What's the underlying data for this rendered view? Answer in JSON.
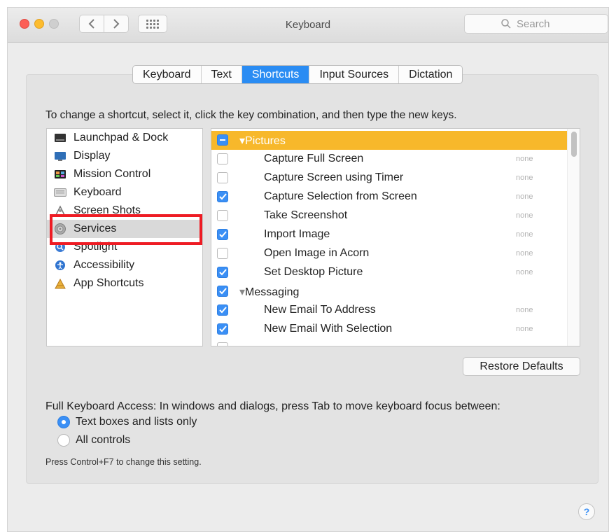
{
  "window": {
    "title": "Keyboard",
    "search_placeholder": "Search"
  },
  "tabs": [
    {
      "label": "Keyboard",
      "active": false
    },
    {
      "label": "Text",
      "active": false
    },
    {
      "label": "Shortcuts",
      "active": true
    },
    {
      "label": "Input Sources",
      "active": false
    },
    {
      "label": "Dictation",
      "active": false
    }
  ],
  "instructions": "To change a shortcut, select it, click the key combination, and then type the new keys.",
  "categories": [
    {
      "label": "Launchpad & Dock",
      "icon": "launchpad-dock-icon"
    },
    {
      "label": "Display",
      "icon": "display-icon"
    },
    {
      "label": "Mission Control",
      "icon": "mission-control-icon"
    },
    {
      "label": "Keyboard",
      "icon": "keyboard-icon"
    },
    {
      "label": "Screen Shots",
      "icon": "screenshots-icon"
    },
    {
      "label": "Services",
      "icon": "services-gear-icon",
      "selected": true
    },
    {
      "label": "Spotlight",
      "icon": "spotlight-icon"
    },
    {
      "label": "Accessibility",
      "icon": "accessibility-icon"
    },
    {
      "label": "App Shortcuts",
      "icon": "app-shortcuts-icon"
    }
  ],
  "shortcuts": [
    {
      "type": "group",
      "label": "Pictures",
      "state": "mixed",
      "selected": true
    },
    {
      "type": "item",
      "label": "Capture Full Screen",
      "checked": false,
      "key": "none"
    },
    {
      "type": "item",
      "label": "Capture Screen using Timer",
      "checked": false,
      "key": "none"
    },
    {
      "type": "item",
      "label": "Capture Selection from Screen",
      "checked": true,
      "key": "none"
    },
    {
      "type": "item",
      "label": "Take Screenshot",
      "checked": false,
      "key": "none"
    },
    {
      "type": "item",
      "label": "Import Image",
      "checked": true,
      "key": "none"
    },
    {
      "type": "item",
      "label": "Open Image in Acorn",
      "checked": false,
      "key": "none"
    },
    {
      "type": "item",
      "label": "Set Desktop Picture",
      "checked": true,
      "key": "none"
    },
    {
      "type": "group",
      "label": "Messaging",
      "state": "checked",
      "selected": false
    },
    {
      "type": "item",
      "label": "New Email To Address",
      "checked": true,
      "key": "none"
    },
    {
      "type": "item",
      "label": "New Email With Selection",
      "checked": true,
      "key": "none"
    }
  ],
  "restore_button": "Restore Defaults",
  "full_keyboard_access": {
    "label": "Full Keyboard Access: In windows and dialogs, press Tab to move keyboard focus between:",
    "options": [
      {
        "label": "Text boxes and lists only",
        "selected": true
      },
      {
        "label": "All controls",
        "selected": false
      }
    ],
    "hint": "Press Control+F7 to change this setting."
  },
  "help_button": "?",
  "colors": {
    "accent": "#2a8cf3",
    "group_highlight": "#f7b82b",
    "annotation": "#ee1c24"
  }
}
